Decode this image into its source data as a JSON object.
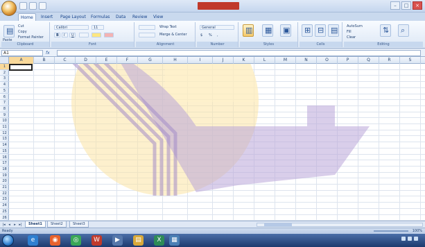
{
  "window": {
    "title": "",
    "controls": [
      "–",
      "□",
      "×"
    ]
  },
  "ribbon": {
    "tabs": [
      "Home",
      "Insert",
      "Page Layout",
      "Formulas",
      "Data",
      "Review",
      "View"
    ],
    "groups": [
      {
        "name": "clipboard",
        "label": "Clipboard",
        "items": [
          "Paste",
          "Cut",
          "Copy",
          "Format Painter"
        ]
      },
      {
        "name": "font",
        "label": "Font",
        "items": [
          "Calibri",
          "11",
          "B",
          "I",
          "U"
        ]
      },
      {
        "name": "alignment",
        "label": "Alignment",
        "items": [
          "Wrap Text",
          "Merge & Center"
        ]
      },
      {
        "name": "number",
        "label": "Number",
        "items": [
          "General",
          "$",
          "%",
          ","
        ]
      },
      {
        "name": "styles",
        "label": "Styles",
        "items": [
          "Conditional Formatting",
          "Format as Table",
          "Cell Styles"
        ]
      },
      {
        "name": "cells",
        "label": "Cells",
        "items": [
          "Insert",
          "Delete",
          "Format"
        ]
      },
      {
        "name": "editing",
        "label": "Editing",
        "items": [
          "AutoSum",
          "Fill",
          "Clear",
          "Sort & Filter",
          "Find & Select"
        ]
      }
    ]
  },
  "formula_bar": {
    "name_box": "A1",
    "fx": "fx",
    "value": ""
  },
  "grid": {
    "columns": [
      "A",
      "B",
      "C",
      "D",
      "E",
      "F",
      "G",
      "H",
      "I",
      "J",
      "K",
      "L",
      "M",
      "N",
      "O",
      "P",
      "Q",
      "R",
      "S"
    ],
    "rows": [
      "1",
      "2",
      "3",
      "4",
      "5",
      "6",
      "7",
      "8",
      "9",
      "10",
      "11",
      "12",
      "13",
      "14",
      "15",
      "16",
      "17",
      "18",
      "19",
      "20",
      "21",
      "22",
      "23",
      "24",
      "25",
      "26"
    ],
    "active_cell": "A1"
  },
  "sheets": {
    "nav": [
      "|◂",
      "◂",
      "▸",
      "▸|"
    ],
    "tabs": [
      "Sheet1",
      "Sheet2",
      "Sheet3"
    ],
    "active": "Sheet1"
  },
  "status": {
    "text": "Ready",
    "zoom": "100%"
  },
  "taskbar": {
    "apps": [
      {
        "name": "ie-icon",
        "glyph": "e",
        "color": "#2f7fd0"
      },
      {
        "name": "firefox-icon",
        "glyph": "◉",
        "color": "#e8622c"
      },
      {
        "name": "chrome-icon",
        "glyph": "◎",
        "color": "#3aa757"
      },
      {
        "name": "word-icon",
        "glyph": "W",
        "color": "#c0392b"
      },
      {
        "name": "media-icon",
        "glyph": "▶",
        "color": "#5577aa"
      },
      {
        "name": "folder-icon",
        "glyph": "▤",
        "color": "#d8a93a"
      },
      {
        "name": "excel-icon",
        "glyph": "X",
        "color": "#2e8b57"
      },
      {
        "name": "paint-icon",
        "glyph": "▦",
        "color": "#4a7fb5"
      }
    ],
    "clock": ""
  }
}
